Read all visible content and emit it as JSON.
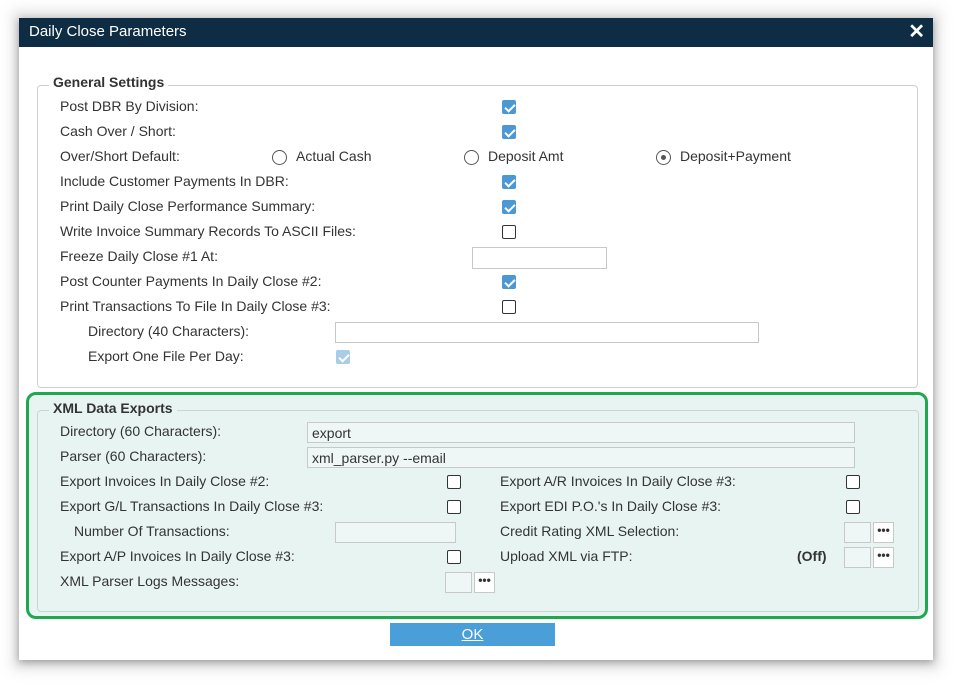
{
  "dialog": {
    "title": "Daily Close Parameters",
    "ok_label": "OK"
  },
  "general": {
    "legend": "General Settings",
    "post_dbr_by_division": {
      "label": "Post DBR By Division:",
      "checked": true
    },
    "cash_over_short": {
      "label": "Cash Over / Short:",
      "checked": true
    },
    "over_short_default": {
      "label": "Over/Short Default:",
      "options": [
        "Actual Cash",
        "Deposit Amt",
        "Deposit+Payment"
      ],
      "selected": "Deposit+Payment"
    },
    "include_customer_payments": {
      "label": "Include Customer Payments In DBR:",
      "checked": true
    },
    "print_performance_summary": {
      "label": "Print Daily Close Performance Summary:",
      "checked": true
    },
    "write_invoice_summary": {
      "label": "Write Invoice Summary Records To ASCII Files:",
      "checked": false
    },
    "freeze_daily_close": {
      "label": "Freeze Daily Close #1 At:",
      "value": ""
    },
    "post_counter_payments": {
      "label": "Post Counter Payments In Daily Close #2:",
      "checked": true
    },
    "print_transactions_to_file": {
      "label": "Print Transactions To File In Daily Close #3:",
      "checked": false
    },
    "directory_40": {
      "label": "Directory (40 Characters):",
      "value": ""
    },
    "export_one_file_per_day": {
      "label": "Export One File Per Day:",
      "checked": true,
      "disabled": true
    }
  },
  "xml": {
    "legend": "XML Data Exports",
    "directory": {
      "label": "Directory (60 Characters):",
      "value": "export"
    },
    "parser": {
      "label": "Parser (60 Characters):",
      "value": "xml_parser.py  --email"
    },
    "export_invoices_dc2": {
      "label": "Export Invoices In Daily Close #2:",
      "checked": false
    },
    "export_gl_dc3": {
      "label": "Export G/L Transactions In Daily Close #3:",
      "checked": false
    },
    "number_of_transactions": {
      "label": "Number Of Transactions:",
      "value": ""
    },
    "export_ap_dc3": {
      "label": "Export A/P Invoices In Daily Close #3:",
      "checked": false
    },
    "xml_parser_logs": {
      "label": "XML Parser Logs Messages:",
      "value": ""
    },
    "export_ar_dc3": {
      "label": "Export A/R Invoices In Daily Close #3:",
      "checked": false
    },
    "export_edi_dc3": {
      "label": "Export EDI P.O.'s In Daily Close #3:",
      "checked": false
    },
    "credit_rating_selection": {
      "label": "Credit Rating XML Selection:",
      "value": ""
    },
    "upload_xml_ftp": {
      "label": "Upload XML via FTP:",
      "status": "(Off)",
      "value": ""
    },
    "ellipsis_label": "•••"
  },
  "colors": {
    "titlebar": "#0e2d45",
    "accent": "#4b98d4",
    "highlight": "#1fa84f"
  }
}
